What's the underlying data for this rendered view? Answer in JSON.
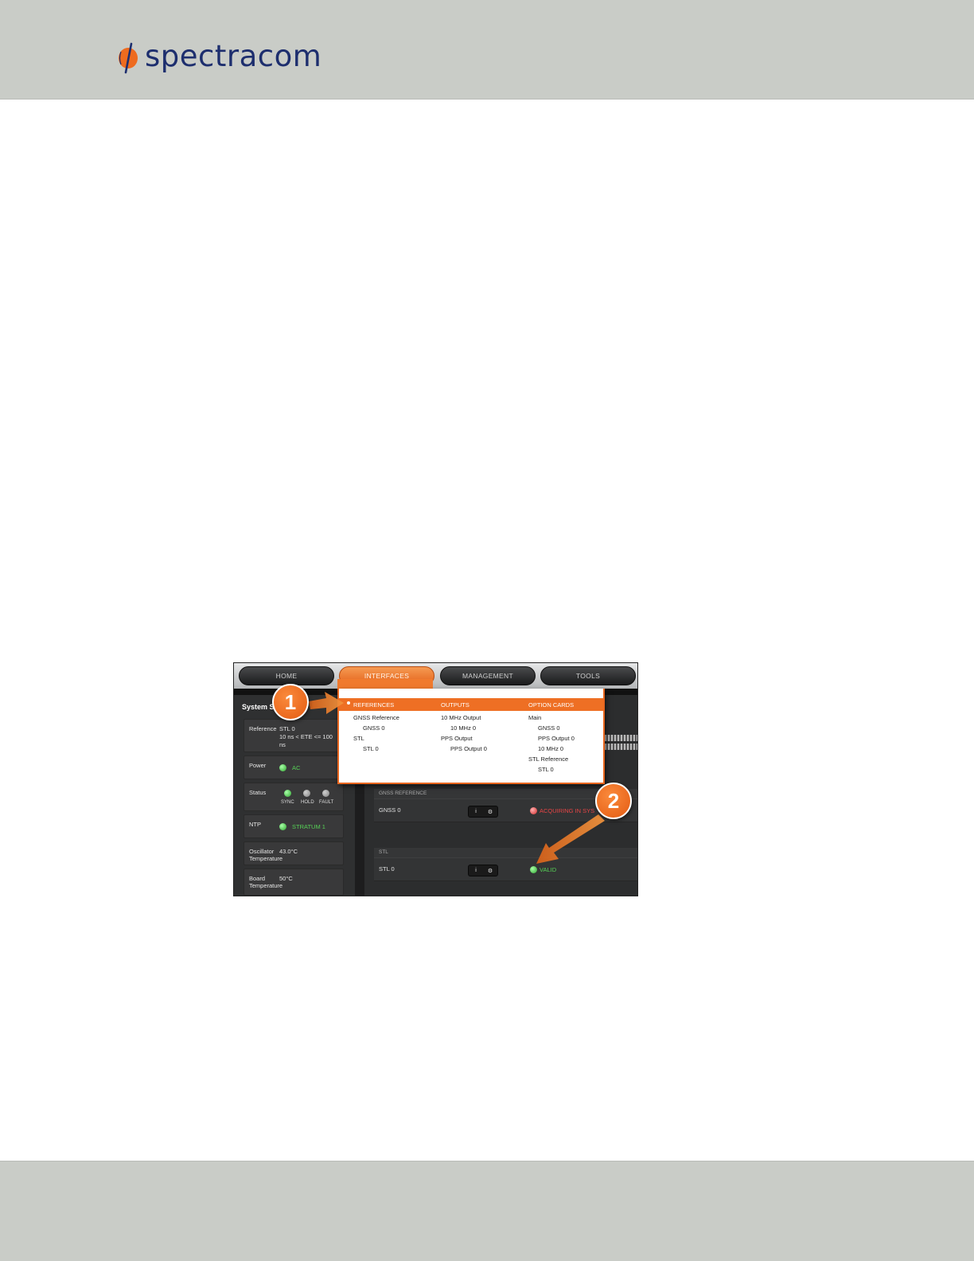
{
  "brand": {
    "logo_text": "spectracom",
    "logo_color": "#1d2e6e",
    "accent_color": "#e8661f"
  },
  "nav": {
    "tabs": [
      "HOME",
      "INTERFACES",
      "MANAGEMENT",
      "TOOLS"
    ],
    "active": "INTERFACES"
  },
  "dropdown": {
    "headers": [
      "REFERENCES",
      "OUTPUTS",
      "OPTION CARDS"
    ],
    "references": [
      "GNSS Reference",
      "GNSS 0",
      "STL",
      "STL 0"
    ],
    "outputs": [
      "10 MHz Output",
      "10 MHz 0",
      "PPS Output",
      "PPS Output 0"
    ],
    "option_cards": [
      "Main",
      "GNSS 0",
      "PPS Output 0",
      "10 MHz 0",
      "STL Reference",
      "STL 0"
    ]
  },
  "sidebar": {
    "title": "System St",
    "reference": {
      "label": "Reference",
      "value_line1": "STL 0",
      "value_line2": "10 ns < ETE <= 100",
      "value_line3": "ns"
    },
    "power": {
      "label": "Power",
      "value": "AC"
    },
    "status": {
      "label": "Status",
      "leds": [
        "SYNC",
        "HOLD",
        "FAULT"
      ]
    },
    "ntp": {
      "label": "NTP",
      "value": "STRATUM 1"
    },
    "oscillator": {
      "label_line1": "Oscillator",
      "label_line2": "Temperature",
      "value": "43.0°C"
    },
    "board": {
      "label_line1": "Board",
      "label_line2": "Temperature",
      "value": "50°C"
    }
  },
  "main": {
    "gnss_section": "GNSS REFERENCE",
    "gnss_row": {
      "name": "GNSS 0",
      "btn1": "i",
      "btn2": "⚙",
      "state": "ACQUIRING IN SYS"
    },
    "stl_section": "STL",
    "stl_row": {
      "name": "STL 0",
      "btn1": "i",
      "btn2": "⚙",
      "state": "VALID"
    }
  },
  "callouts": [
    "1",
    "2"
  ]
}
